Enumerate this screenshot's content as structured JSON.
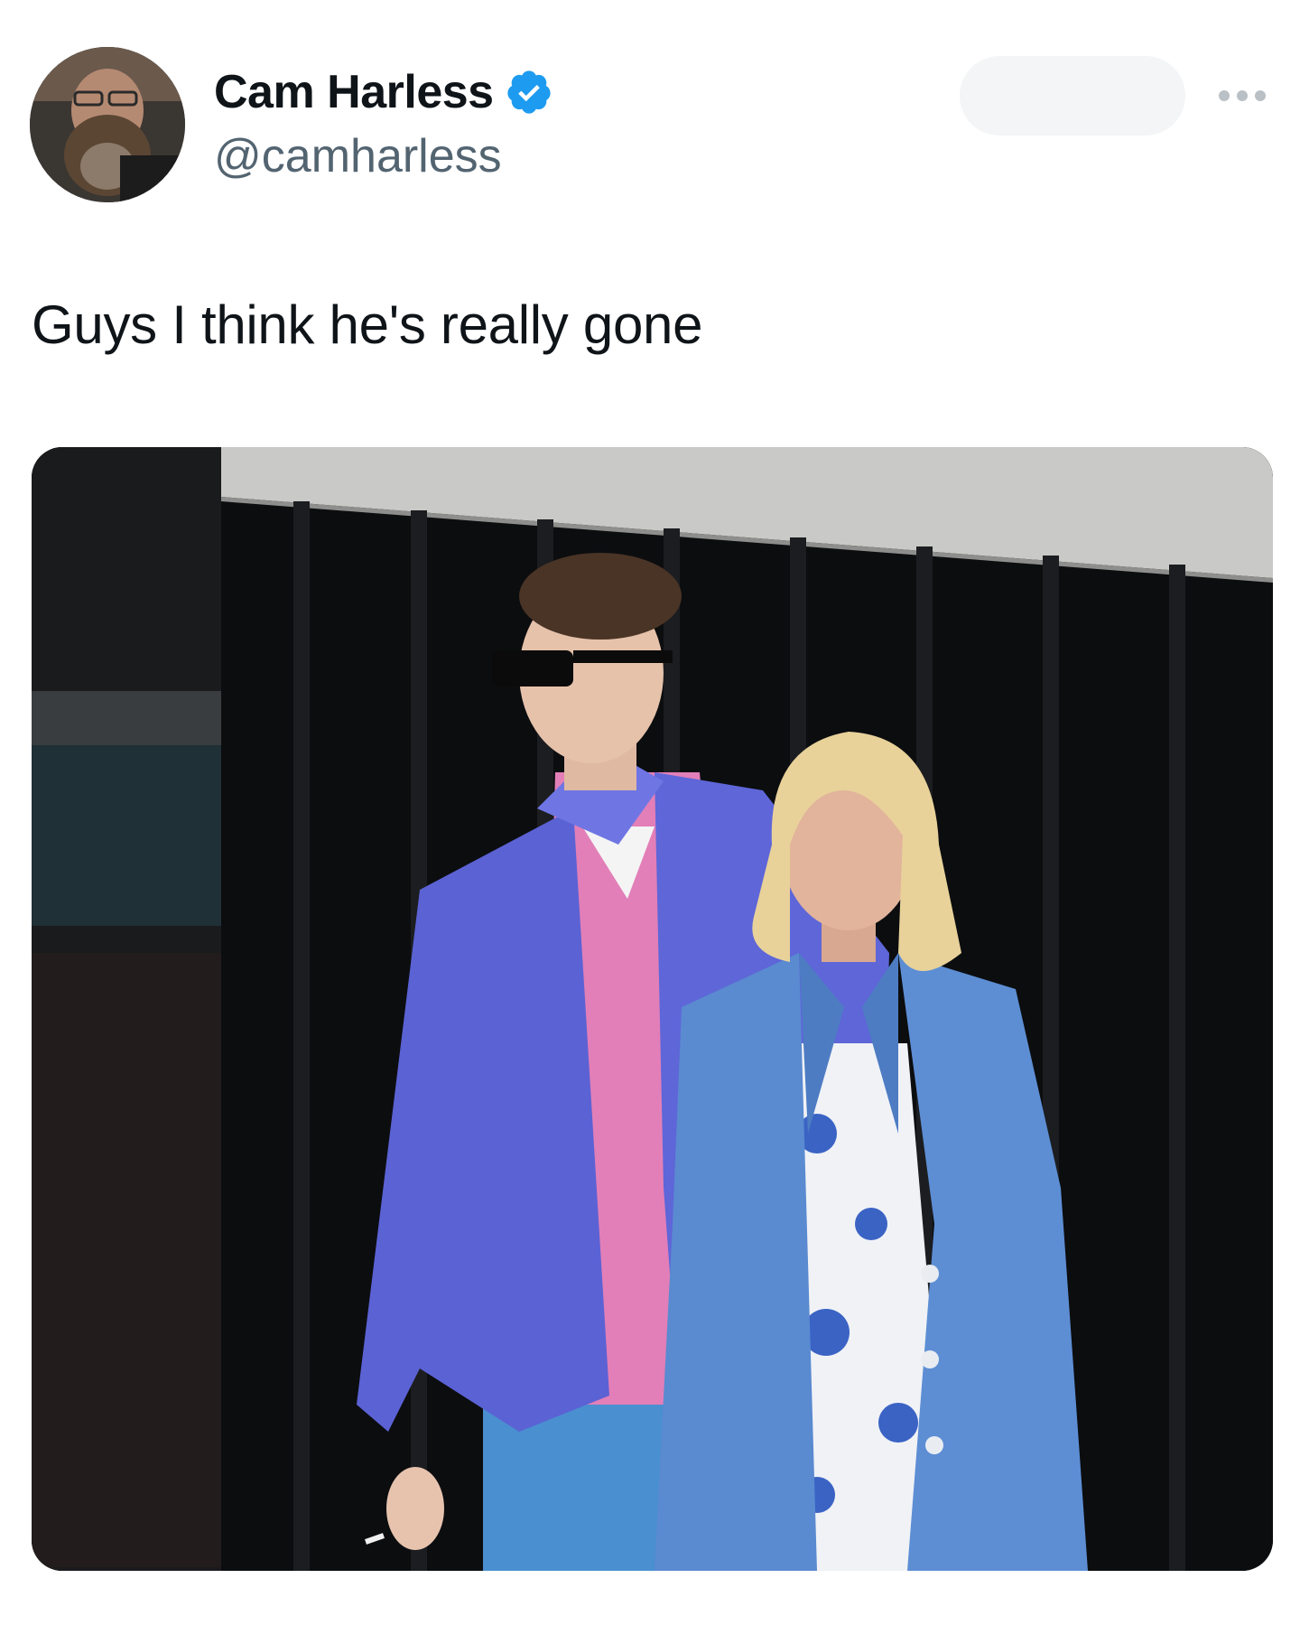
{
  "tweet": {
    "author": {
      "display_name": "Cam Harless",
      "handle": "@camharless",
      "verified": true,
      "verified_icon": "verified-badge-icon",
      "verified_color": "#1d9bf0"
    },
    "text": "Guys I think he's really gone",
    "more_icon": "more-dots-icon",
    "media_subject": "photo of two people walking outside a dark building"
  },
  "colors": {
    "text_primary": "#0f1419",
    "text_secondary": "#536471",
    "accent": "#1d9bf0"
  }
}
